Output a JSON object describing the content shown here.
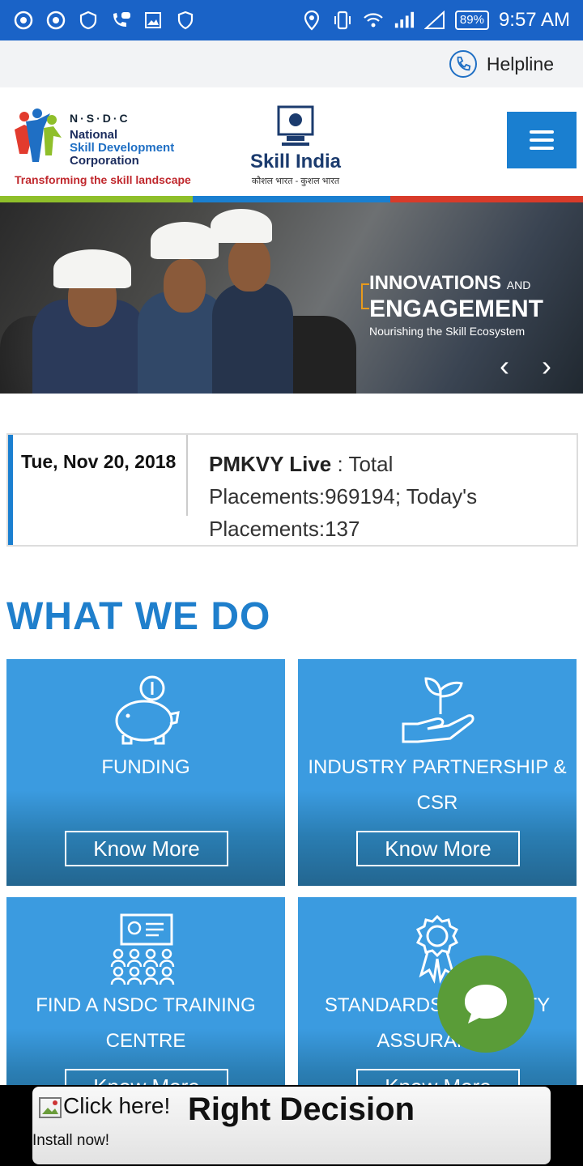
{
  "status_bar": {
    "battery": "89%",
    "time": "9:57 AM"
  },
  "helpline": {
    "label": "Helpline"
  },
  "header": {
    "nsdc_title": "N·S·D·C",
    "nsdc_line1": "National",
    "nsdc_line2": "Skill Development",
    "nsdc_line3": "Corporation",
    "nsdc_tagline": "Transforming the skill landscape",
    "skill_india": "Skill India",
    "skill_india_sub": "कौशल भारत - कुशल भारत",
    "strip_colors": [
      "#8fbf2a",
      "#1a7fd0",
      "#d83b2a"
    ]
  },
  "banner": {
    "line1": "INNOVATIONS",
    "line1_small": "AND",
    "line2": "ENGAGEMENT",
    "line3": "Nourishing the Skill Ecosystem",
    "prev": "‹",
    "next": "›"
  },
  "ticker": {
    "date": "Tue, Nov 20, 2018",
    "label": "PMKVY Live",
    "text": " : Total Placements:969194; Today's Placements:137"
  },
  "section": {
    "title": "WHAT WE DO"
  },
  "cards": [
    {
      "icon": "piggy-bank-icon",
      "title": "FUNDING",
      "button": "Know More"
    },
    {
      "icon": "hand-plant-icon",
      "title": "INDUSTRY PARTNERSHIP & CSR",
      "button": "Know More"
    },
    {
      "icon": "training-centre-icon",
      "title": "FIND A NSDC TRAINING CENTRE",
      "button": "Know More"
    },
    {
      "icon": "award-ribbon-icon",
      "title": "STANDARDS & QUALITY ASSURANCE",
      "button": "Know More"
    }
  ],
  "ad": {
    "image_alt": "Click here!",
    "headline": "Right Decision",
    "sub": "Install now!"
  }
}
